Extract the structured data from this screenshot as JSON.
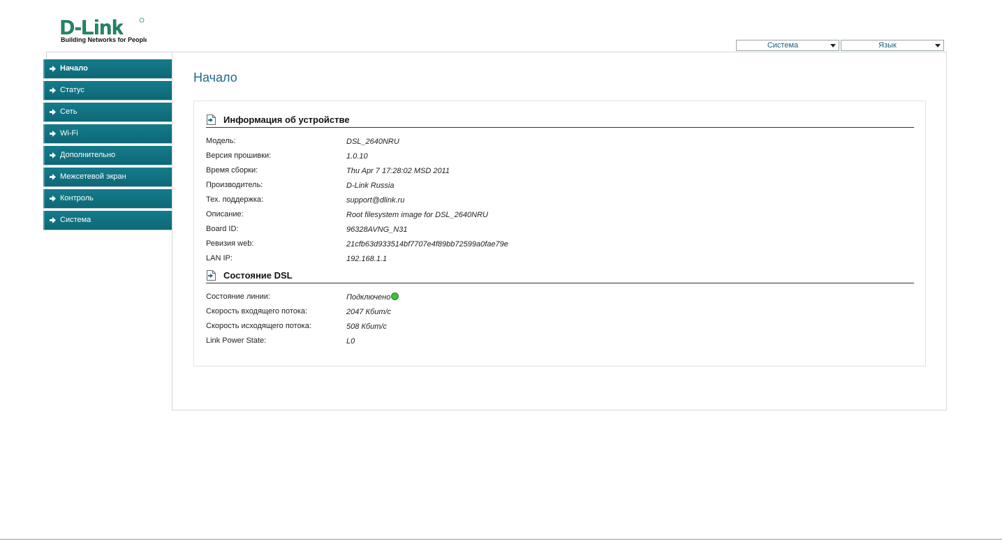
{
  "logo": {
    "brand": "D-Link",
    "tagline": "Building Networks for People"
  },
  "top_menu": {
    "system_label": "Система",
    "language_label": "Язык"
  },
  "sidebar": {
    "items": [
      {
        "label": "Начало",
        "active": true
      },
      {
        "label": "Статус",
        "active": false
      },
      {
        "label": "Сеть",
        "active": false
      },
      {
        "label": "Wi-Fi",
        "active": false
      },
      {
        "label": "Дополнительно",
        "active": false
      },
      {
        "label": "Межсетевой экран",
        "active": false
      },
      {
        "label": "Контроль",
        "active": false
      },
      {
        "label": "Система",
        "active": false
      }
    ]
  },
  "main": {
    "title": "Начало",
    "device_info": {
      "heading": "Информация об устройстве",
      "rows": [
        {
          "key": "Модель:",
          "value": "DSL_2640NRU"
        },
        {
          "key": "Версия прошивки:",
          "value": "1.0.10"
        },
        {
          "key": "Время сборки:",
          "value": "Thu Apr 7 17:28:02 MSD 2011"
        },
        {
          "key": "Производитель:",
          "value": "D-Link Russia"
        },
        {
          "key": "Тех. поддержка:",
          "value": "support@dlink.ru"
        },
        {
          "key": "Описание:",
          "value": "Root filesystem image for DSL_2640NRU"
        },
        {
          "key": "Board ID:",
          "value": "96328AVNG_N31"
        },
        {
          "key": "Ревизия web:",
          "value": "21cfb63d933514bf7707e4f89bb72599a0fae79e"
        },
        {
          "key": "LAN IP:",
          "value": "192.168.1.1"
        }
      ]
    },
    "dsl_status": {
      "heading": "Состояние DSL",
      "rows": [
        {
          "key": "Состояние линии:",
          "value": "Подключено",
          "status_color": "#3dbf3d"
        },
        {
          "key": "Скорость входящего потока:",
          "value": "2047 Кбит/с"
        },
        {
          "key": "Скорость исходящего потока:",
          "value": "508 Кбит/с"
        },
        {
          "key": "Link Power State:",
          "value": "L0"
        }
      ]
    }
  },
  "colors": {
    "menu_bg": "#0d6877",
    "title": "#1d6a86",
    "brand_green": "#1f8a64",
    "status_ok": "#3dbf3d"
  }
}
